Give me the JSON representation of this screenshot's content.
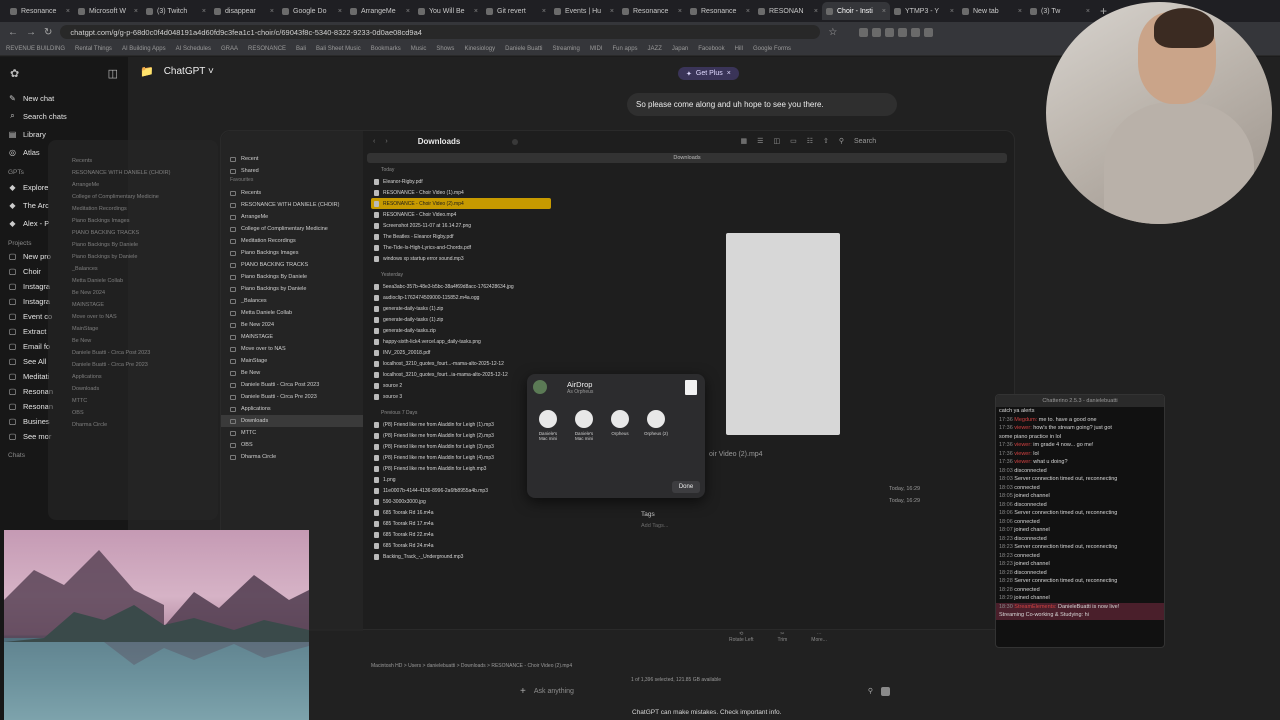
{
  "browser": {
    "tabs": [
      {
        "label": "Resonance"
      },
      {
        "label": "Microsoft W"
      },
      {
        "label": "(3) Twitch"
      },
      {
        "label": "disappear"
      },
      {
        "label": "Google Do"
      },
      {
        "label": "ArrangeMe"
      },
      {
        "label": "You Will Be"
      },
      {
        "label": "Git revert"
      },
      {
        "label": "Events | Hu"
      },
      {
        "label": "Resonance"
      },
      {
        "label": "Resonance"
      },
      {
        "label": "RESONAN"
      },
      {
        "label": "Choir - Insti",
        "active": true
      },
      {
        "label": "YTMP3 - Y"
      },
      {
        "label": "New tab"
      },
      {
        "label": "(3) Tw"
      }
    ],
    "url": "chatgpt.com/g/g-p-68d0c0f4d048191a4d60fd9c3fea1c1-choir/c/69043f8c-5340-8322-9233-0d0ae08cd9a4",
    "bookmarks": [
      "REVENUE BUILDING",
      "Rental Things",
      "AI Building Apps",
      "AI Schedules",
      "GRAA",
      "RESONANCE",
      "Bali",
      "Bali Sheet Music",
      "Bookmarks",
      "Music",
      "Shows",
      "Kinesiology",
      "Daniele Buatti",
      "Streaming",
      "MIDI",
      "Fun apps",
      "JAZZ",
      "Japan",
      "Facebook",
      "Hill",
      "Google Forms"
    ]
  },
  "chatgpt": {
    "sidebar": {
      "items": [
        {
          "icon": "edit-icon",
          "label": "New chat"
        },
        {
          "icon": "search-icon",
          "label": "Search chats"
        },
        {
          "icon": "library-icon",
          "label": "Library"
        },
        {
          "icon": "atlas-icon",
          "label": "Atlas"
        }
      ],
      "gpts_label": "GPTs",
      "gpts": [
        "Explore",
        "The Arc",
        "Alex - P"
      ],
      "projects_label": "Projects",
      "projects": [
        "New pro",
        "Choir",
        "Instagra",
        "Instagra",
        "Event co",
        "Extract",
        "Email fo",
        "See All",
        "Meditati",
        "Resonan",
        "Resonan",
        "Busines",
        "See mor"
      ],
      "chats_label": "Chats"
    },
    "header_title": "ChatGPT",
    "get_plus": "Get Plus",
    "message": "So please come along and uh hope to see you there.",
    "composer_placeholder": "Ask anything",
    "disclaimer": "ChatGPT can make mistakes. Check important info."
  },
  "finder": {
    "title": "Downloads",
    "path": "Downloads",
    "search_placeholder": "Search",
    "sidebar": {
      "recents": "Recent",
      "shared": "Shared",
      "favourites_label": "Favourites",
      "items": [
        "Recents",
        "RESONANCE WITH DANIELE (CHOIR)",
        "ArrangeMe",
        "College of Complimentary Medicine",
        "Meditation Recordings",
        "Piano Backings Images",
        "PIANO BACKING TRACKS",
        "Piano Backings By Daniele",
        "Piano Backings by Daniele",
        "_Balances",
        "Metta Daniele Collab",
        "Be New 2024",
        "MAINSTAGE",
        "Move over to NAS",
        "MainStage",
        "Be New",
        "Daniele Buatti - Circa Post 2023",
        "Daniele Buatti - Circa Pre 2023",
        "Applications",
        "Downloads",
        "MTTC",
        "OBS",
        "Dharma Circle"
      ]
    },
    "groups": [
      {
        "label": "Today",
        "files": [
          "Eleanor-Rigby.pdf",
          "RESONANCE - Choir Video (1).mp4",
          "RESONANCE - Choir Video (2).mp4",
          "RESONANCE - Choir Video.mp4",
          "Screenshot 2025-11-07 at 16.14.27.png",
          "The Beatles - Eleanor Rigby.pdf",
          "The-Tide-Is-High-Lyrics-and-Chords.pdf",
          "windows xp startup error sound.mp3"
        ]
      },
      {
        "label": "Yesterday",
        "files": [
          "5eea3abc-357b-48e3-b5bc-38a4f69d8acc-1762428634.jpg",
          "audioclip-1762474509000-115852.m4a.ogg",
          "generate-daily-tasks (1).zip",
          "generate-daily-tasks (1).zip",
          "generate-daily-tasks.zip",
          "happy-sixth-lick4.vercel.app_daily-tasks.png",
          "INV_2025_20018.pdf",
          "localhost_3210_quotes_fourt...-mama-alto-2025-12-12",
          "localhost_3210_quotes_fourt...ia-mama-alto-2025-12-12",
          "source 2",
          "source 3"
        ]
      },
      {
        "label": "Previous 7 Days",
        "files": [
          "(P8) Friend like me from Aladdin for Leigh (1).mp3",
          "(P8) Friend like me from Aladdin for Leigh (2).mp3",
          "(P8) Friend like me from Aladdin for Leigh (3).mp3",
          "(P8) Friend like me from Aladdin for Leigh (4).mp3",
          "(P8) Friend like me from Aladdin for Leigh.mp3",
          "1.png",
          "11e0007b-4144-4136-8996-2a6fb8955a4b.mp3",
          "590-3000x3000.jpg",
          "685 Toorak Rd 16.m4a",
          "685 Toorak Rd 17.m4a",
          "685 Toorak Rd 22.m4a",
          "685 Toorak Rd 24.m4a",
          "Backing_Track_-_Underground.mp3"
        ]
      }
    ],
    "selected_index": 2,
    "preview_name": "oir Video (2).mp4",
    "meta": [
      "Today, 16:29",
      "Today, 16:29"
    ],
    "tags_label": "Tags",
    "tags_placeholder": "Add Tags...",
    "quicklook_actions": [
      "Rotate Left",
      "Trim",
      "More..."
    ],
    "status": "1 of 1,396 selected, 121.85 GB available",
    "bottom_path": "Macintosh HD > Users > danielebuatti > Downloads > RESONANCE - Choir Video (2).mp4"
  },
  "airdrop": {
    "title": "AirDrop",
    "subtitle": "As Orpheus",
    "devices": [
      {
        "label": "Daniele's Mac mini"
      },
      {
        "label": "Daniele's Mac mini"
      },
      {
        "label": "Orpheus"
      },
      {
        "label": "Orpheus (2)"
      }
    ],
    "done": "Done"
  },
  "chatterino": {
    "title": "Chatterino 2.5.3 - danielebuatti",
    "lines": [
      {
        "time": "",
        "user": "",
        "text": "catch ya alerts"
      },
      {
        "time": "17:36",
        "user": "Megdum:",
        "text": "me to. have a good one"
      },
      {
        "time": "17:36",
        "user": "viewer:",
        "text": "how's the stream going? just got"
      },
      {
        "time": "",
        "user": "",
        "text": "some piano practice in lol"
      },
      {
        "time": "17:36",
        "user": "viewer:",
        "text": "im grade 4 now... go me!"
      },
      {
        "time": "17:36",
        "user": "viewer:",
        "text": "lol"
      },
      {
        "time": "17:36",
        "user": "viewer:",
        "text": "what u doing?"
      },
      {
        "time": "18:03",
        "user": "",
        "text": "disconnected"
      },
      {
        "time": "18:03",
        "user": "",
        "text": "Server connection timed out, reconnecting"
      },
      {
        "time": "18:03",
        "user": "",
        "text": "connected"
      },
      {
        "time": "18:05",
        "user": "",
        "text": "joined channel"
      },
      {
        "time": "18:06",
        "user": "",
        "text": "disconnected"
      },
      {
        "time": "18:06",
        "user": "",
        "text": "Server connection timed out, reconnecting"
      },
      {
        "time": "18:06",
        "user": "",
        "text": "connected"
      },
      {
        "time": "18:07",
        "user": "",
        "text": "joined channel"
      },
      {
        "time": "18:23",
        "user": "",
        "text": "disconnected"
      },
      {
        "time": "18:23",
        "user": "",
        "text": "Server connection timed out, reconnecting"
      },
      {
        "time": "18:23",
        "user": "",
        "text": "connected"
      },
      {
        "time": "18:23",
        "user": "",
        "text": "joined channel"
      },
      {
        "time": "18:28",
        "user": "",
        "text": "disconnected"
      },
      {
        "time": "18:28",
        "user": "",
        "text": "Server connection timed out, reconnecting"
      },
      {
        "time": "18:28",
        "user": "",
        "text": "connected"
      },
      {
        "time": "18:29",
        "user": "",
        "text": "joined channel"
      },
      {
        "time": "18:30",
        "user": "StreamElements:",
        "text": "DanieleBuatti is now live!",
        "live": true
      },
      {
        "time": "",
        "user": "",
        "text": "Streaming Co-working & Studying: hi",
        "live": true
      }
    ]
  }
}
